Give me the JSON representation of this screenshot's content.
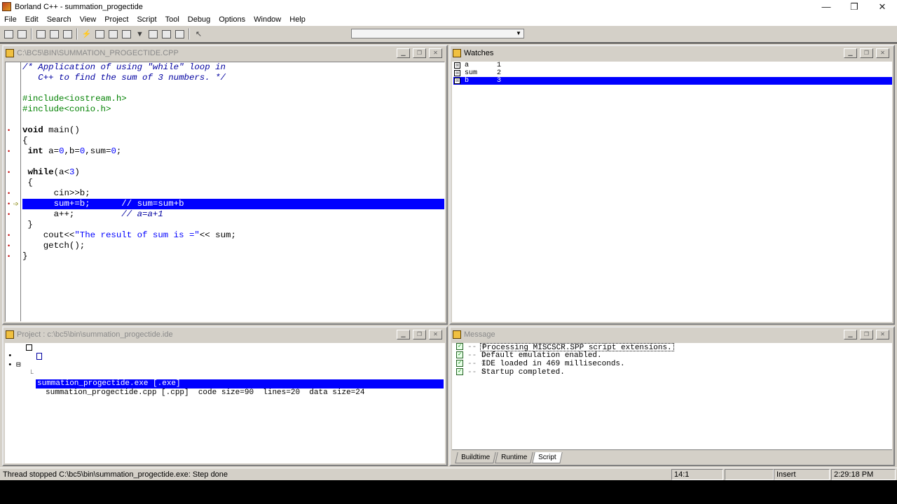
{
  "window": {
    "title": "Borland C++ - summation_progectide",
    "minimize": "—",
    "restore": "❐",
    "close": "✕"
  },
  "menu": [
    "File",
    "Edit",
    "Search",
    "View",
    "Project",
    "Script",
    "Tool",
    "Debug",
    "Options",
    "Window",
    "Help"
  ],
  "toolbar": {
    "combo_value": ""
  },
  "editor": {
    "title": "C:\\BC5\\BIN\\SUMMATION_PROGECTIDE.CPP"
  },
  "watches": {
    "title": "Watches",
    "rows": [
      {
        "name": "a",
        "value": "1",
        "checked": "☒"
      },
      {
        "name": "sum",
        "value": "2",
        "checked": "☒"
      },
      {
        "name": "b",
        "value": "3",
        "checked": "☒"
      }
    ]
  },
  "project": {
    "title": "Project : c:\\bc5\\bin\\summation_progectide.ide",
    "rows": [
      {
        "text": "summation_progectide.exe [.exe]"
      },
      {
        "text": "summation_progectide.cpp [.cpp]  code size=90  lines=20  data size=24"
      }
    ]
  },
  "message": {
    "title": "Message",
    "rows": [
      "Processing MISCSCR.SPP script extensions.",
      "Default emulation enabled.",
      "IDE loaded in 469 milliseconds.",
      "Startup completed."
    ],
    "tabs": [
      "Buildtime",
      "Runtime",
      "Script"
    ]
  },
  "status": {
    "message": "Thread stopped C:\\bc5\\bin\\summation_progectide.exe: Step done",
    "position": "14:1",
    "blank": "",
    "mode": "Insert",
    "time": "2:29:18 PM"
  }
}
